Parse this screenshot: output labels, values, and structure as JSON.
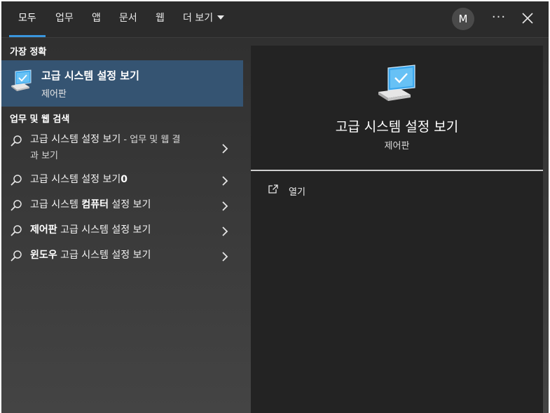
{
  "tabs": [
    {
      "label": "모두",
      "active": true
    },
    {
      "label": "업무"
    },
    {
      "label": "앱"
    },
    {
      "label": "문서"
    },
    {
      "label": "웹"
    },
    {
      "label": "더 보기"
    }
  ],
  "header": {
    "avatar_initial": "M",
    "more_label": "···"
  },
  "left": {
    "best_match_label": "가장 정확",
    "best_match": {
      "title": "고급 시스템 설정 보기",
      "subtitle": "제어판",
      "icon": "computer-settings-icon"
    },
    "web_section_label": "업무 및 웹 검색",
    "results": [
      {
        "normal_a": "고급 시스템 설정 보기",
        "dim": " - 업무 및 웹 결",
        "line2": "과 보기"
      },
      {
        "normal_a": "고급 시스템 설정 보기",
        "bold": "0"
      },
      {
        "normal_a": "고급 시스템 ",
        "bold": "컴퓨터",
        "normal_b": " 설정 보기"
      },
      {
        "bold": "제어판",
        "normal_b": " 고급 시스템 설정 보기"
      },
      {
        "bold": "윈도우",
        "normal_b": " 고급 시스템 설정 보기"
      }
    ]
  },
  "detail": {
    "title": "고급 시스템 설정 보기",
    "subtitle": "제어판",
    "actions": [
      {
        "label": "열기",
        "icon": "open-external-icon"
      }
    ]
  },
  "colors": {
    "accent": "#3a96dd",
    "selection": "#355472",
    "detail_bg": "#232323"
  }
}
